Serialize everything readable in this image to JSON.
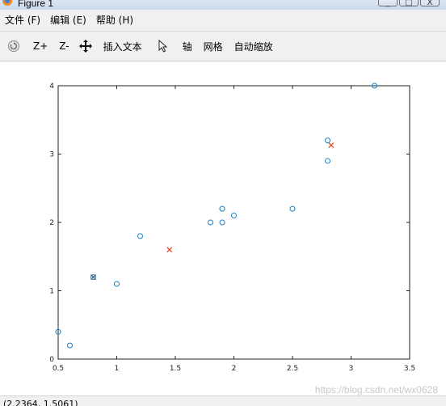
{
  "window": {
    "title": "Figure 1",
    "controls": [
      "_",
      "□",
      "X"
    ]
  },
  "menu": [
    {
      "label": "文件 (F)"
    },
    {
      "label": "编辑 (E)"
    },
    {
      "label": "帮助 (H)"
    }
  ],
  "toolbar": {
    "rotate_icon": "rotate-icon",
    "zoom_in": "Z+",
    "zoom_out": "Z-",
    "pan_icon": "pan-icon",
    "insert_text": "插入文本",
    "select_icon": "cursor-icon",
    "axis": "轴",
    "grid": "网格",
    "autoscale": "自动缩放"
  },
  "statusbar": {
    "coords": "(2.2364, 1.5061)"
  },
  "watermark": "https://blog.csdn.net/wx0628",
  "colors": {
    "points": "#1f7fc0",
    "centroids": "#e0441a",
    "selected": "#555555"
  },
  "chart_data": {
    "type": "scatter",
    "title": "",
    "xlabel": "",
    "ylabel": "",
    "xlim": [
      0.5,
      3.5
    ],
    "ylim": [
      0,
      4
    ],
    "xticks": [
      "0.5",
      "1",
      "1.5",
      "2",
      "2.5",
      "3",
      "3.5"
    ],
    "yticks": [
      "0",
      "1",
      "2",
      "3",
      "4"
    ],
    "grid": false,
    "series": [
      {
        "marker": "o",
        "points": [
          {
            "x": 0.5,
            "y": 0.4
          },
          {
            "x": 0.6,
            "y": 0.2
          },
          {
            "x": 0.8,
            "y": 1.2
          },
          {
            "x": 1.0,
            "y": 1.1
          },
          {
            "x": 1.2,
            "y": 1.8
          },
          {
            "x": 1.8,
            "y": 2.0
          },
          {
            "x": 1.9,
            "y": 2.0
          },
          {
            "x": 1.9,
            "y": 2.2
          },
          {
            "x": 2.0,
            "y": 2.1
          },
          {
            "x": 2.5,
            "y": 2.2
          },
          {
            "x": 2.8,
            "y": 2.9
          },
          {
            "x": 2.8,
            "y": 3.2
          },
          {
            "x": 3.2,
            "y": 4.0
          }
        ]
      },
      {
        "marker": "x",
        "points": [
          {
            "x": 1.45,
            "y": 1.6
          },
          {
            "x": 2.83,
            "y": 3.13
          },
          {
            "x": 0.8,
            "y": 1.2
          }
        ]
      }
    ]
  }
}
